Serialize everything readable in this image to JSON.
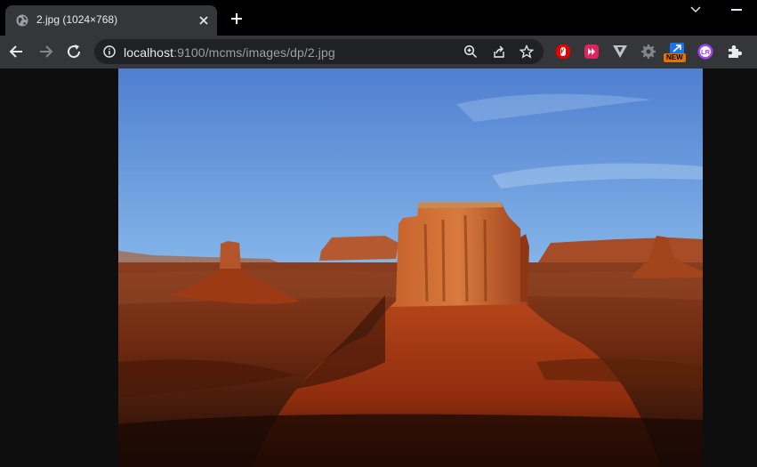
{
  "browser": {
    "tab": {
      "title": "2.jpg (1024×768)",
      "favicon": "globe-icon"
    },
    "toolbar": {
      "url_host": "localhost",
      "url_path": ":9100/mcms/images/dp/2.jpg"
    },
    "extensions": [
      {
        "name": "adblock-extension-icon",
        "color": "#e60000"
      },
      {
        "name": "video-extension-icon",
        "color": "#e0245e"
      },
      {
        "name": "v-extension-icon",
        "color": "#bdc1c6"
      },
      {
        "name": "settings-extension-icon",
        "color": "#80868b"
      },
      {
        "name": "new-extension-icon",
        "color": "#1a73e8",
        "badge": "NEW"
      },
      {
        "name": "lr-extension-icon",
        "color": "#a142f4"
      },
      {
        "name": "puzzle-extensions-icon",
        "color": "#e8eaed"
      }
    ]
  },
  "image": {
    "description_icon": "desert-buttes-photo"
  }
}
